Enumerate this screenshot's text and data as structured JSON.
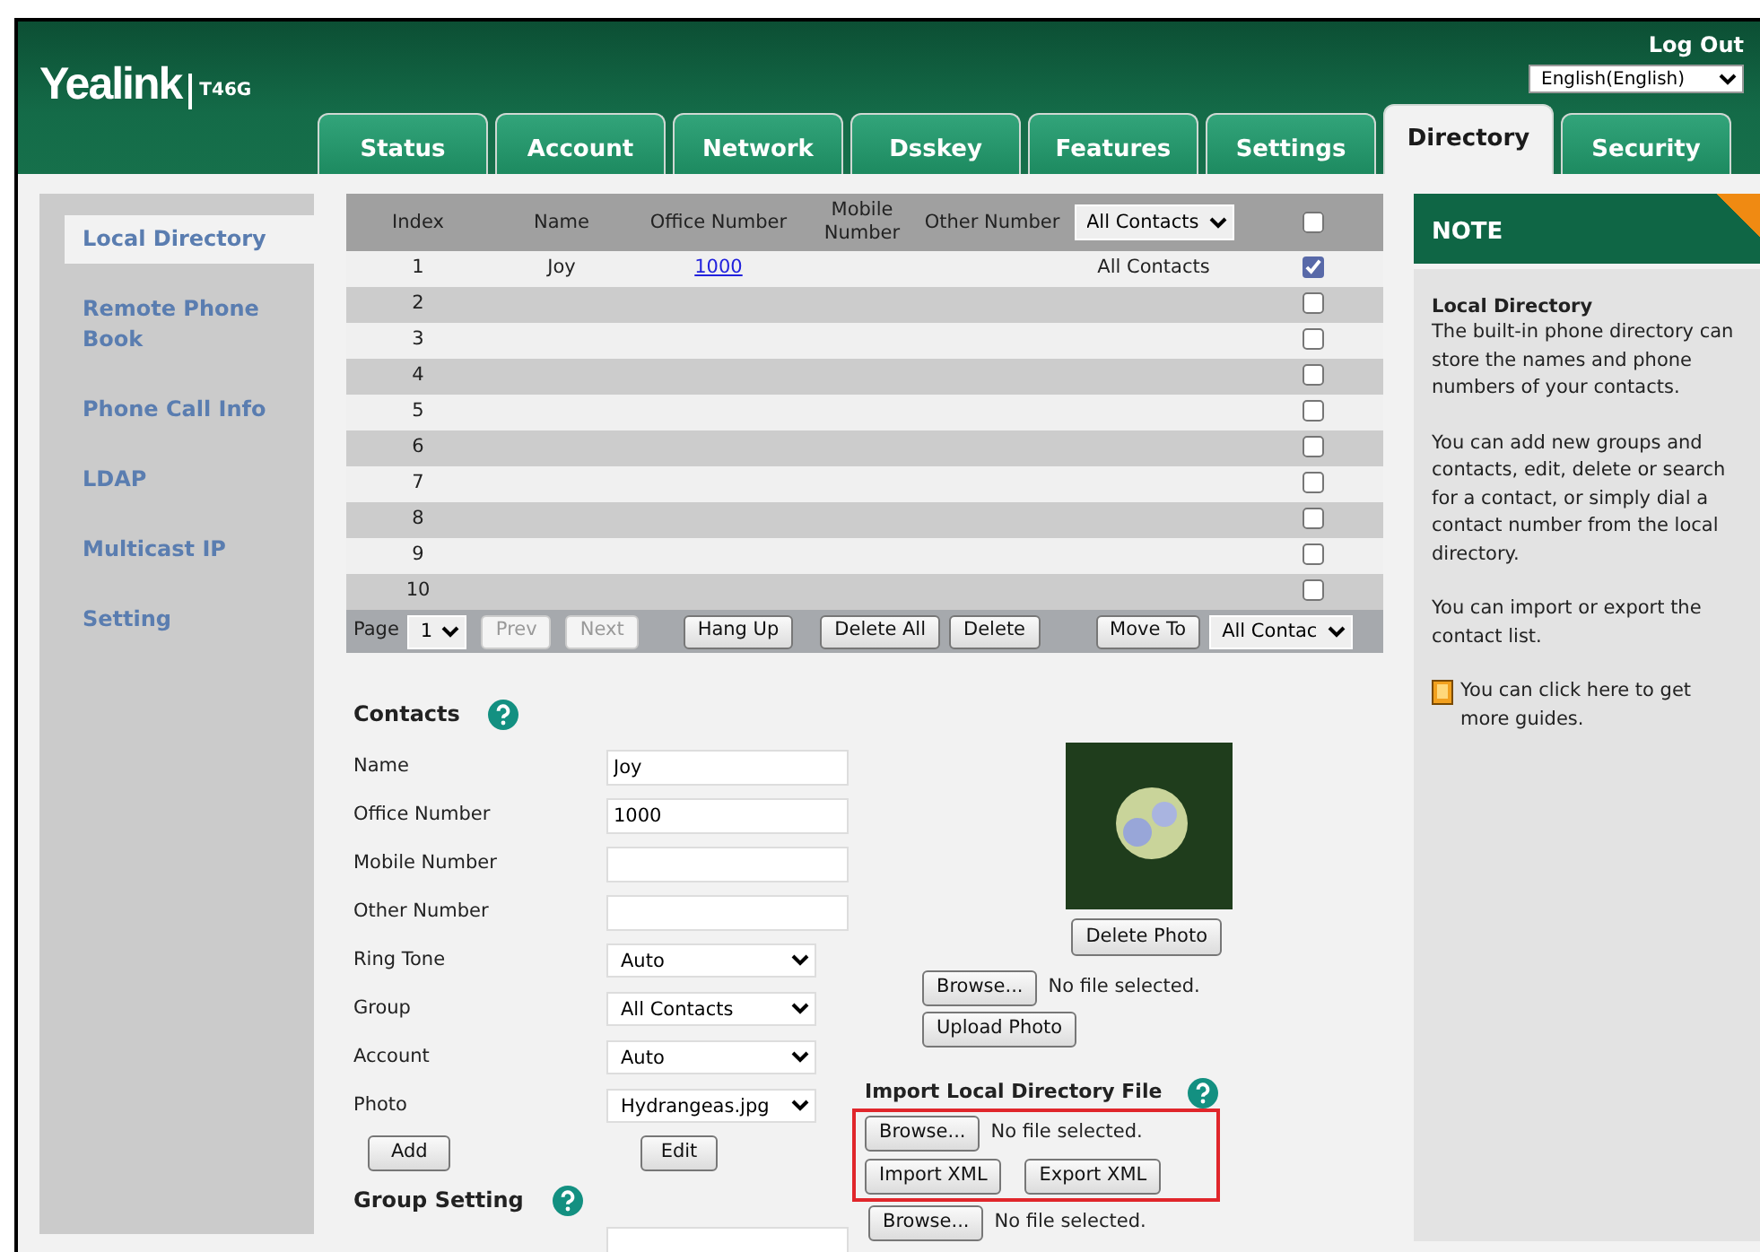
{
  "header": {
    "brand": "Yealink",
    "model": "T46G",
    "logout": "Log Out",
    "language": "English(English)"
  },
  "tabs": [
    {
      "label": "Status",
      "selected": false
    },
    {
      "label": "Account",
      "selected": false
    },
    {
      "label": "Network",
      "selected": false
    },
    {
      "label": "Dsskey",
      "selected": false
    },
    {
      "label": "Features",
      "selected": false
    },
    {
      "label": "Settings",
      "selected": false
    },
    {
      "label": "Directory",
      "selected": true
    },
    {
      "label": "Security",
      "selected": false
    }
  ],
  "sidebar": {
    "items": [
      {
        "label": "Local Directory",
        "selected": true
      },
      {
        "label": "Remote Phone Book",
        "selected": false
      },
      {
        "label": "Phone Call Info",
        "selected": false
      },
      {
        "label": "LDAP",
        "selected": false
      },
      {
        "label": "Multicast IP",
        "selected": false
      },
      {
        "label": "Setting",
        "selected": false
      }
    ]
  },
  "contacts_table": {
    "columns": [
      "Index",
      "Name",
      "Office Number",
      "Mobile Number",
      "Other Number"
    ],
    "group_filter": "All Contacts",
    "select_all_checked": false,
    "rows": [
      {
        "index": "1",
        "name": "Joy",
        "office_number": "1000",
        "group": "All Contacts",
        "checked": true
      },
      {
        "index": "2",
        "checked": false
      },
      {
        "index": "3",
        "checked": false
      },
      {
        "index": "4",
        "checked": false
      },
      {
        "index": "5",
        "checked": false
      },
      {
        "index": "6",
        "checked": false
      },
      {
        "index": "7",
        "checked": false
      },
      {
        "index": "8",
        "checked": false
      },
      {
        "index": "9",
        "checked": false
      },
      {
        "index": "10",
        "checked": false
      }
    ]
  },
  "pager": {
    "page_label": "Page",
    "page": "1",
    "nav": [
      {
        "label": "Prev",
        "disabled": true
      },
      {
        "label": "Next",
        "disabled": true
      }
    ],
    "actions": [
      "Hang Up",
      "Delete All",
      "Delete"
    ],
    "move": "Move To",
    "move_target": "All Contac"
  },
  "contacts_form": {
    "title": "Contacts",
    "fields": [
      {
        "label": "Name",
        "kind": "text",
        "value": "Joy"
      },
      {
        "label": "Office Number",
        "kind": "text",
        "value": "1000"
      },
      {
        "label": "Mobile Number",
        "kind": "text"
      },
      {
        "label": "Other Number",
        "kind": "text"
      },
      {
        "label": "Ring Tone",
        "kind": "select",
        "value": "Auto"
      },
      {
        "label": "Group",
        "kind": "select",
        "value": "All Contacts"
      },
      {
        "label": "Account",
        "kind": "select",
        "value": "Auto"
      },
      {
        "label": "Photo",
        "kind": "select",
        "value": "Hydrangeas.jpg"
      }
    ],
    "add": "Add",
    "edit": "Edit"
  },
  "photo": {
    "delete": "Delete Photo",
    "browse": "Browse...",
    "file_status": "No file selected.",
    "upload": "Upload Photo"
  },
  "import": {
    "title": "Import Local Directory File",
    "browse": "Browse...",
    "file_status": "No file selected.",
    "import": "Import XML",
    "export": "Export XML"
  },
  "group_setting": {
    "title": "Group Setting",
    "browse": "Browse...",
    "file_status": "No file selected."
  },
  "note": {
    "title": "NOTE",
    "heading": "Local Directory",
    "paragraphs": [
      "The built-in phone directory can store the names and phone numbers of your contacts.",
      "You can add new groups and contacts, edit, delete or search for a contact, or simply dial a contact number from the local directory.",
      "You can import or export the contact list."
    ],
    "guide": "You can click here to get more guides."
  }
}
